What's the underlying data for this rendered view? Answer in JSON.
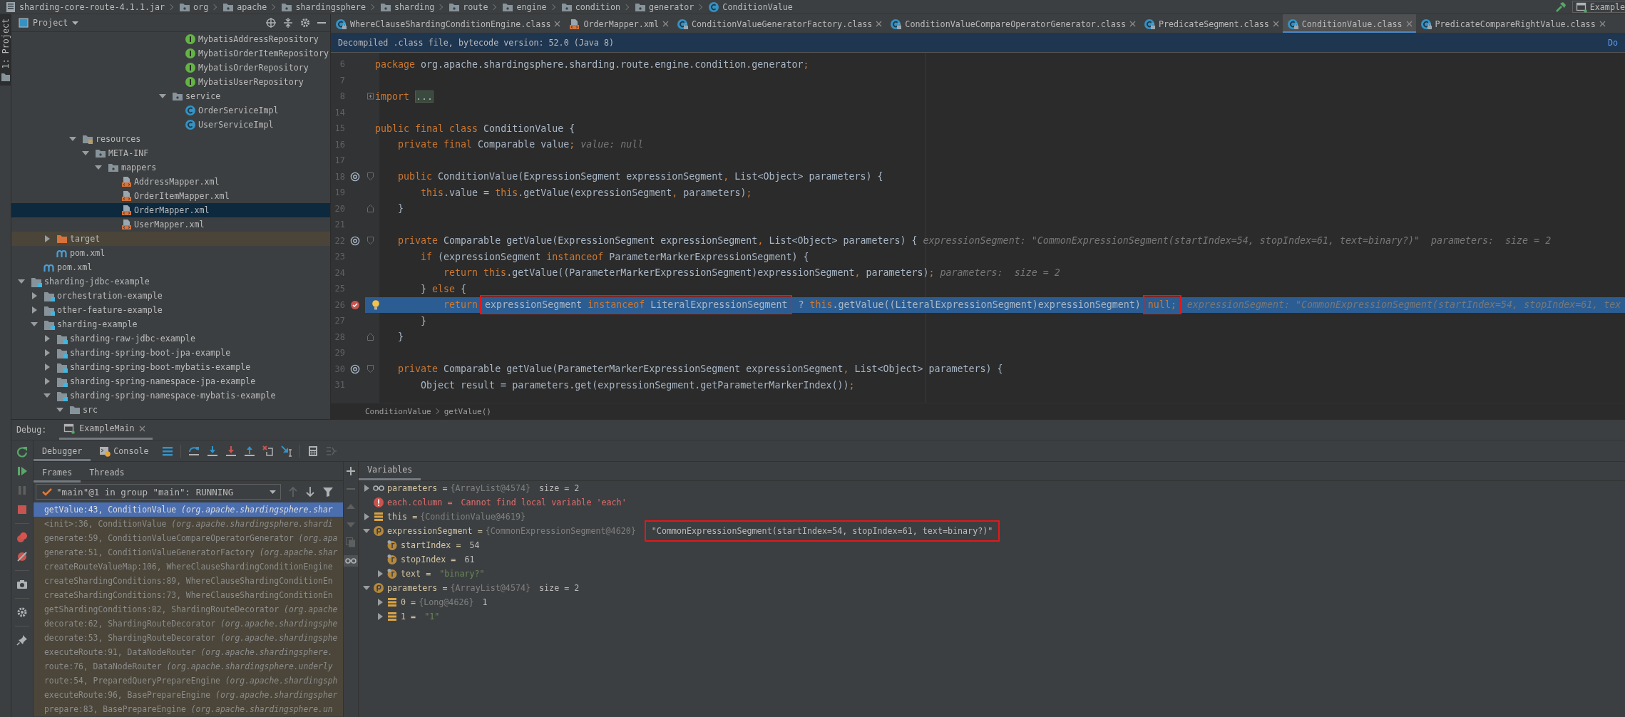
{
  "navigation_bar": {
    "breadcrumbs": [
      {
        "label": "sharding-core-route-4.1.1.jar",
        "kind": "jar"
      },
      {
        "label": "org",
        "kind": "package"
      },
      {
        "label": "apache",
        "kind": "package"
      },
      {
        "label": "shardingsphere",
        "kind": "package"
      },
      {
        "label": "sharding",
        "kind": "package"
      },
      {
        "label": "route",
        "kind": "package"
      },
      {
        "label": "engine",
        "kind": "package"
      },
      {
        "label": "condition",
        "kind": "package"
      },
      {
        "label": "generator",
        "kind": "package"
      },
      {
        "label": "ConditionValue",
        "kind": "class"
      }
    ],
    "run_configuration": "Example"
  },
  "project_panel": {
    "side_tab": "1: Project",
    "title": "Project",
    "tree": [
      {
        "children": [
          {
            "children": [
              {
                "children": [
                  {
                    "children": [
                      {
                        "children": [
                          {
                            "children": [
                              {
                                "children": [
                                  {
                                    "children": [
                                      {
                                        "children": [
                                          {
                                            "children": [
                                              {
                                                "children": [
                                                  {
                                                    "children": [
                                                      {
                                                        "label": "MybatisAddressRepository",
                                                        "kind": "interface",
                                                        "selected": false
                                                      },
                                                      {
                                                        "label": "MybatisOrderItemRepository",
                                                        "kind": "interface",
                                                        "selected": false
                                                      },
                                                      {
                                                        "label": "MybatisOrderRepository",
                                                        "kind": "interface",
                                                        "selected": false
                                                      },
                                                      {
                                                        "label": "MybatisUserRepository",
                                                        "kind": "interface",
                                                        "selected": false
                                                      }
                                                    ]
                                                  },
                                                  {
                                                    "label": "service",
                                                    "kind": "package",
                                                    "expanded": true,
                                                    "selected": false,
                                                    "children": [
                                                      {
                                                        "label": "OrderServiceImpl",
                                                        "kind": "class",
                                                        "selected": false
                                                      },
                                                      {
                                                        "label": "UserServiceImpl",
                                                        "kind": "class",
                                                        "selected": false
                                                      }
                                                    ]
                                                  }
                                                ]
                                              }
                                            ]
                                          }
                                        ]
                                      }
                                    ]
                                  }
                                ]
                              }
                            ]
                          }
                        ]
                      },
                      {
                        "label": "resources",
                        "kind": "resources",
                        "expanded": true,
                        "selected": false,
                        "children": [
                          {
                            "label": "META-INF",
                            "kind": "package",
                            "expanded": true,
                            "selected": false,
                            "children": [
                              {
                                "label": "mappers",
                                "kind": "package",
                                "expanded": true,
                                "selected": false,
                                "children": [
                                  {
                                    "label": "AddressMapper.xml",
                                    "kind": "xml",
                                    "selected": false
                                  },
                                  {
                                    "label": "OrderItemMapper.xml",
                                    "kind": "xml",
                                    "selected": false
                                  },
                                  {
                                    "label": "OrderMapper.xml",
                                    "kind": "xml",
                                    "selected": true
                                  },
                                  {
                                    "label": "UserMapper.xml",
                                    "kind": "xml",
                                    "selected": false
                                  }
                                ]
                              }
                            ]
                          }
                        ]
                      }
                    ]
                  }
                ]
              },
              {
                "label": "target",
                "kind": "excluded",
                "expanded": false,
                "selected": false
              },
              {
                "label": "pom.xml",
                "kind": "maven",
                "selected": false
              }
            ]
          },
          {
            "label": "pom.xml",
            "kind": "maven",
            "selected": false
          }
        ]
      },
      {
        "label": "sharding-jdbc-example",
        "kind": "module",
        "expanded": true,
        "selected": false,
        "children": [
          {
            "label": "orchestration-example",
            "kind": "module",
            "expanded": false,
            "selected": false
          },
          {
            "label": "other-feature-example",
            "kind": "module",
            "expanded": false,
            "selected": false
          },
          {
            "label": "sharding-example",
            "kind": "module",
            "expanded": true,
            "selected": false,
            "children": [
              {
                "label": "sharding-raw-jdbc-example",
                "kind": "module",
                "expanded": false,
                "selected": false
              },
              {
                "label": "sharding-spring-boot-jpa-example",
                "kind": "module",
                "expanded": false,
                "selected": false
              },
              {
                "label": "sharding-spring-boot-mybatis-example",
                "kind": "module",
                "expanded": false,
                "selected": false
              },
              {
                "label": "sharding-spring-namespace-jpa-example",
                "kind": "module",
                "expanded": false,
                "selected": false
              },
              {
                "label": "sharding-spring-namespace-mybatis-example",
                "kind": "module",
                "expanded": true,
                "selected": false,
                "children": [
                  {
                    "label": "src",
                    "kind": "folder",
                    "expanded": true,
                    "selected": false
                  }
                ]
              }
            ]
          }
        ]
      }
    ]
  },
  "editor": {
    "tabs": [
      {
        "label": "WhereClauseShardingConditionEngine.class",
        "kind": "class",
        "selected": false
      },
      {
        "label": "OrderMapper.xml",
        "kind": "xml",
        "selected": false
      },
      {
        "label": "ConditionValueGeneratorFactory.class",
        "kind": "class",
        "selected": false
      },
      {
        "label": "ConditionValueCompareOperatorGenerator.class",
        "kind": "class",
        "selected": false
      },
      {
        "label": "PredicateSegment.class",
        "kind": "class",
        "selected": false
      },
      {
        "label": "ConditionValue.class",
        "kind": "class",
        "selected": true
      },
      {
        "label": "PredicateCompareRightValue.class",
        "kind": "class",
        "selected": false
      }
    ],
    "banner": "Decompiled .class file, bytecode version: 52.0 (Java 8)",
    "banner_link": "Do",
    "lines": [
      {
        "number": "6",
        "current": false,
        "code": [
          {
            "text": "package ",
            "kind": "keyword"
          },
          {
            "text": "org.apache.shardingsphere.sharding.route.engine.condition.generator",
            "kind": "plain"
          },
          {
            "text": ";",
            "kind": "keyword"
          }
        ]
      },
      {
        "number": "7",
        "current": false
      },
      {
        "number": "8",
        "current": false,
        "folded": true,
        "code": [
          {
            "text": "import ",
            "kind": "keyword"
          },
          {
            "text": "...",
            "kind": "folded"
          }
        ]
      },
      {
        "number": "14",
        "current": false
      },
      {
        "number": "15",
        "current": false,
        "code": [
          {
            "text": "public final class ",
            "kind": "keyword"
          },
          {
            "text": "ConditionValue {",
            "kind": "plain"
          }
        ]
      },
      {
        "number": "16",
        "current": false,
        "code": [
          {
            "text": "    private final ",
            "kind": "keyword"
          },
          {
            "text": "Comparable value",
            "kind": "plain"
          },
          {
            "text": ";",
            "kind": "keyword"
          }
        ],
        "hint": "value: null"
      },
      {
        "number": "17",
        "current": false
      },
      {
        "number": "18",
        "current": false,
        "override_marker": true,
        "fold_start": true,
        "code": [
          {
            "text": "    public ",
            "kind": "keyword"
          },
          {
            "text": "ConditionValue(ExpressionSegment expressionSegment",
            "kind": "plain"
          },
          {
            "text": ", ",
            "kind": "keyword"
          },
          {
            "text": "List<Object> parameters) {",
            "kind": "plain"
          }
        ]
      },
      {
        "number": "19",
        "current": false,
        "code": [
          {
            "text": "        this",
            "kind": "keyword"
          },
          {
            "text": ".value = ",
            "kind": "plain"
          },
          {
            "text": "this",
            "kind": "keyword"
          },
          {
            "text": ".getValue(expressionSegment",
            "kind": "plain"
          },
          {
            "text": ", ",
            "kind": "keyword"
          },
          {
            "text": "parameters)",
            "kind": "plain"
          },
          {
            "text": ";",
            "kind": "keyword"
          }
        ]
      },
      {
        "number": "20",
        "current": false,
        "fold_end": true,
        "code": [
          {
            "text": "    }",
            "kind": "plain"
          }
        ]
      },
      {
        "number": "21",
        "current": false
      },
      {
        "number": "22",
        "current": false,
        "override_marker": true,
        "fold_start": true,
        "code": [
          {
            "text": "    private ",
            "kind": "keyword"
          },
          {
            "text": "Comparable getValue(ExpressionSegment expressionSegment",
            "kind": "plain"
          },
          {
            "text": ", ",
            "kind": "keyword"
          },
          {
            "text": "List<Object> parameters) {",
            "kind": "plain"
          }
        ],
        "hint": "expressionSegment: \"CommonExpressionSegment(startIndex=54, stopIndex=61, text=binary?)\"  parameters:  size = 2"
      },
      {
        "number": "23",
        "current": false,
        "code": [
          {
            "text": "        if ",
            "kind": "keyword"
          },
          {
            "text": "(expressionSegment ",
            "kind": "plain"
          },
          {
            "text": "instanceof ",
            "kind": "keyword"
          },
          {
            "text": "ParameterMarkerExpressionSegment) {",
            "kind": "plain"
          }
        ]
      },
      {
        "number": "24",
        "current": false,
        "code": [
          {
            "text": "            return this",
            "kind": "keyword"
          },
          {
            "text": ".getValue((ParameterMarkerExpressionSegment)expressionSegment",
            "kind": "plain"
          },
          {
            "text": ", ",
            "kind": "keyword"
          },
          {
            "text": "parameters)",
            "kind": "plain"
          },
          {
            "text": ";",
            "kind": "keyword"
          }
        ],
        "hint": "parameters:  size = 2"
      },
      {
        "number": "25",
        "current": false,
        "code": [
          {
            "text": "        } ",
            "kind": "plain"
          },
          {
            "text": "else ",
            "kind": "keyword"
          },
          {
            "text": "{",
            "kind": "plain"
          }
        ]
      },
      {
        "number": "26",
        "current": true,
        "breakpoint": true,
        "bulb": true,
        "code": [
          {
            "text": "            return",
            "kind": "keyword"
          },
          {
            "kind": "boxed",
            "parts": [
              {
                "text": "expressionSegment ",
                "kind": "plain"
              },
              {
                "text": "instanceof ",
                "kind": "keyword"
              },
              {
                "text": "LiteralExpressionSegment",
                "kind": "plain"
              }
            ]
          },
          {
            "text": " ? ",
            "kind": "plain"
          },
          {
            "text": "this",
            "kind": "keyword"
          },
          {
            "text": ".getValue((LiteralExpressionSegment)expressionSegment)",
            "kind": "plain"
          },
          {
            "kind": "boxed",
            "parts": [
              {
                "text": "null;",
                "kind": "keyword"
              }
            ]
          }
        ],
        "hint": "expressionSegment: \"CommonExpressionSegment(startIndex=54, stopIndex=61, tex"
      },
      {
        "number": "27",
        "current": false,
        "code": [
          {
            "text": "        }",
            "kind": "plain"
          }
        ]
      },
      {
        "number": "28",
        "current": false,
        "fold_end": true,
        "code": [
          {
            "text": "    }",
            "kind": "plain"
          }
        ]
      },
      {
        "number": "29",
        "current": false
      },
      {
        "number": "30",
        "current": false,
        "override_marker": true,
        "fold_start": true,
        "code": [
          {
            "text": "    private ",
            "kind": "keyword"
          },
          {
            "text": "Comparable getValue(ParameterMarkerExpressionSegment expressionSegment",
            "kind": "plain"
          },
          {
            "text": ", ",
            "kind": "keyword"
          },
          {
            "text": "List<Object> parameters) {",
            "kind": "plain"
          }
        ]
      },
      {
        "number": "31",
        "current": false,
        "code": [
          {
            "text": "        Object result = parameters.get(expressionSegment.getParameterMarkerIndex())",
            "kind": "plain"
          },
          {
            "text": ";",
            "kind": "keyword"
          }
        ]
      }
    ],
    "breadcrumbs": [
      "ConditionValue",
      "getValue()"
    ]
  },
  "debug": {
    "title": "Debug:",
    "session_tab": "ExampleMain",
    "tabs": [
      {
        "label": "Debugger",
        "selected": true
      },
      {
        "label": "Console",
        "selected": false
      }
    ],
    "frame_tabs": [
      {
        "label": "Frames",
        "selected": true
      },
      {
        "label": "Threads",
        "selected": false
      }
    ],
    "thread": "\"main\"@1 in group \"main\": RUNNING",
    "frames": [
      {
        "text": "getValue:43, ConditionValue *(org.apache.shardingsphere.shar*",
        "selected": true
      },
      {
        "text": "<init>:36, ConditionValue *(org.apache.shardingsphere.shardi*",
        "selected": false
      },
      {
        "text": "generate:59, ConditionValueCompareOperatorGenerator *(org.apa*",
        "selected": false
      },
      {
        "text": "generate:51, ConditionValueGeneratorFactory *(org.apache.shar*",
        "selected": false
      },
      {
        "text": "createRouteValueMap:106, WhereClauseShardingConditionEngine",
        "selected": false
      },
      {
        "text": "createShardingConditions:89, WhereClauseShardingConditionEn",
        "selected": false
      },
      {
        "text": "createShardingConditions:73, WhereClauseShardingConditionEn",
        "selected": false
      },
      {
        "text": "getShardingConditions:82, ShardingRouteDecorator *(org.apache*",
        "selected": false
      },
      {
        "text": "decorate:62, ShardingRouteDecorator *(org.apache.shardingsphe*",
        "selected": false
      },
      {
        "text": "decorate:53, ShardingRouteDecorator *(org.apache.shardingsphe*",
        "selected": false
      },
      {
        "text": "executeRoute:91, DataNodeRouter *(org.apache.shardingsphere.*",
        "selected": false
      },
      {
        "text": "route:76, DataNodeRouter *(org.apache.shardingsphere.underly*",
        "selected": false
      },
      {
        "text": "route:54, PreparedQueryPrepareEngine *(org.apache.shardingsph*",
        "selected": false
      },
      {
        "text": "executeRoute:96, BasePrepareEngine *(org.apache.shardingspher*",
        "selected": false
      },
      {
        "text": "prepare:83, BasePrepareEngine *(org.apache.shardingsphere.un*",
        "selected": false
      }
    ],
    "variables_title": "Variables",
    "variables": [
      {
        "kind": "watch",
        "name": "parameters =",
        "type": "{ArrayList@4574}",
        "value": {
          "text": "size = 2",
          "kind": "plain"
        },
        "expanded": false
      },
      {
        "kind": "error",
        "name": "each.column =",
        "value": {
          "text": "Cannot find local variable 'each'",
          "kind": "error"
        }
      },
      {
        "kind": "object",
        "name": "this =",
        "type": "{ConditionValue@4619}",
        "expanded": false
      },
      {
        "kind": "parameter",
        "name": "expressionSegment =",
        "type": "{CommonExpressionSegment@4620}",
        "value": {
          "text": "\"CommonExpressionSegment(startIndex=54, stopIndex=61, text=binary?)\"",
          "kind": "boxed"
        },
        "expanded": true,
        "children": [
          {
            "kind": "field",
            "name": "startIndex =",
            "value": {
              "text": "54",
              "kind": "plain"
            }
          },
          {
            "kind": "field",
            "name": "stopIndex =",
            "value": {
              "text": "61",
              "kind": "plain"
            }
          },
          {
            "kind": "field",
            "name": "text =",
            "value": {
              "text": "\"binary?\"",
              "kind": "string"
            },
            "expanded": false
          }
        ]
      },
      {
        "kind": "parameter",
        "name": "parameters =",
        "type": "{ArrayList@4574}",
        "value": {
          "text": "size = 2",
          "kind": "plain"
        },
        "expanded": true,
        "children": [
          {
            "kind": "object",
            "name": "0 =",
            "type": "{Long@4626}",
            "value": {
              "text": "1",
              "kind": "plain"
            },
            "expanded": false
          },
          {
            "kind": "object",
            "name": "1 =",
            "value": {
              "text": "\"1\"",
              "kind": "string"
            },
            "expanded": false
          }
        ]
      }
    ]
  }
}
